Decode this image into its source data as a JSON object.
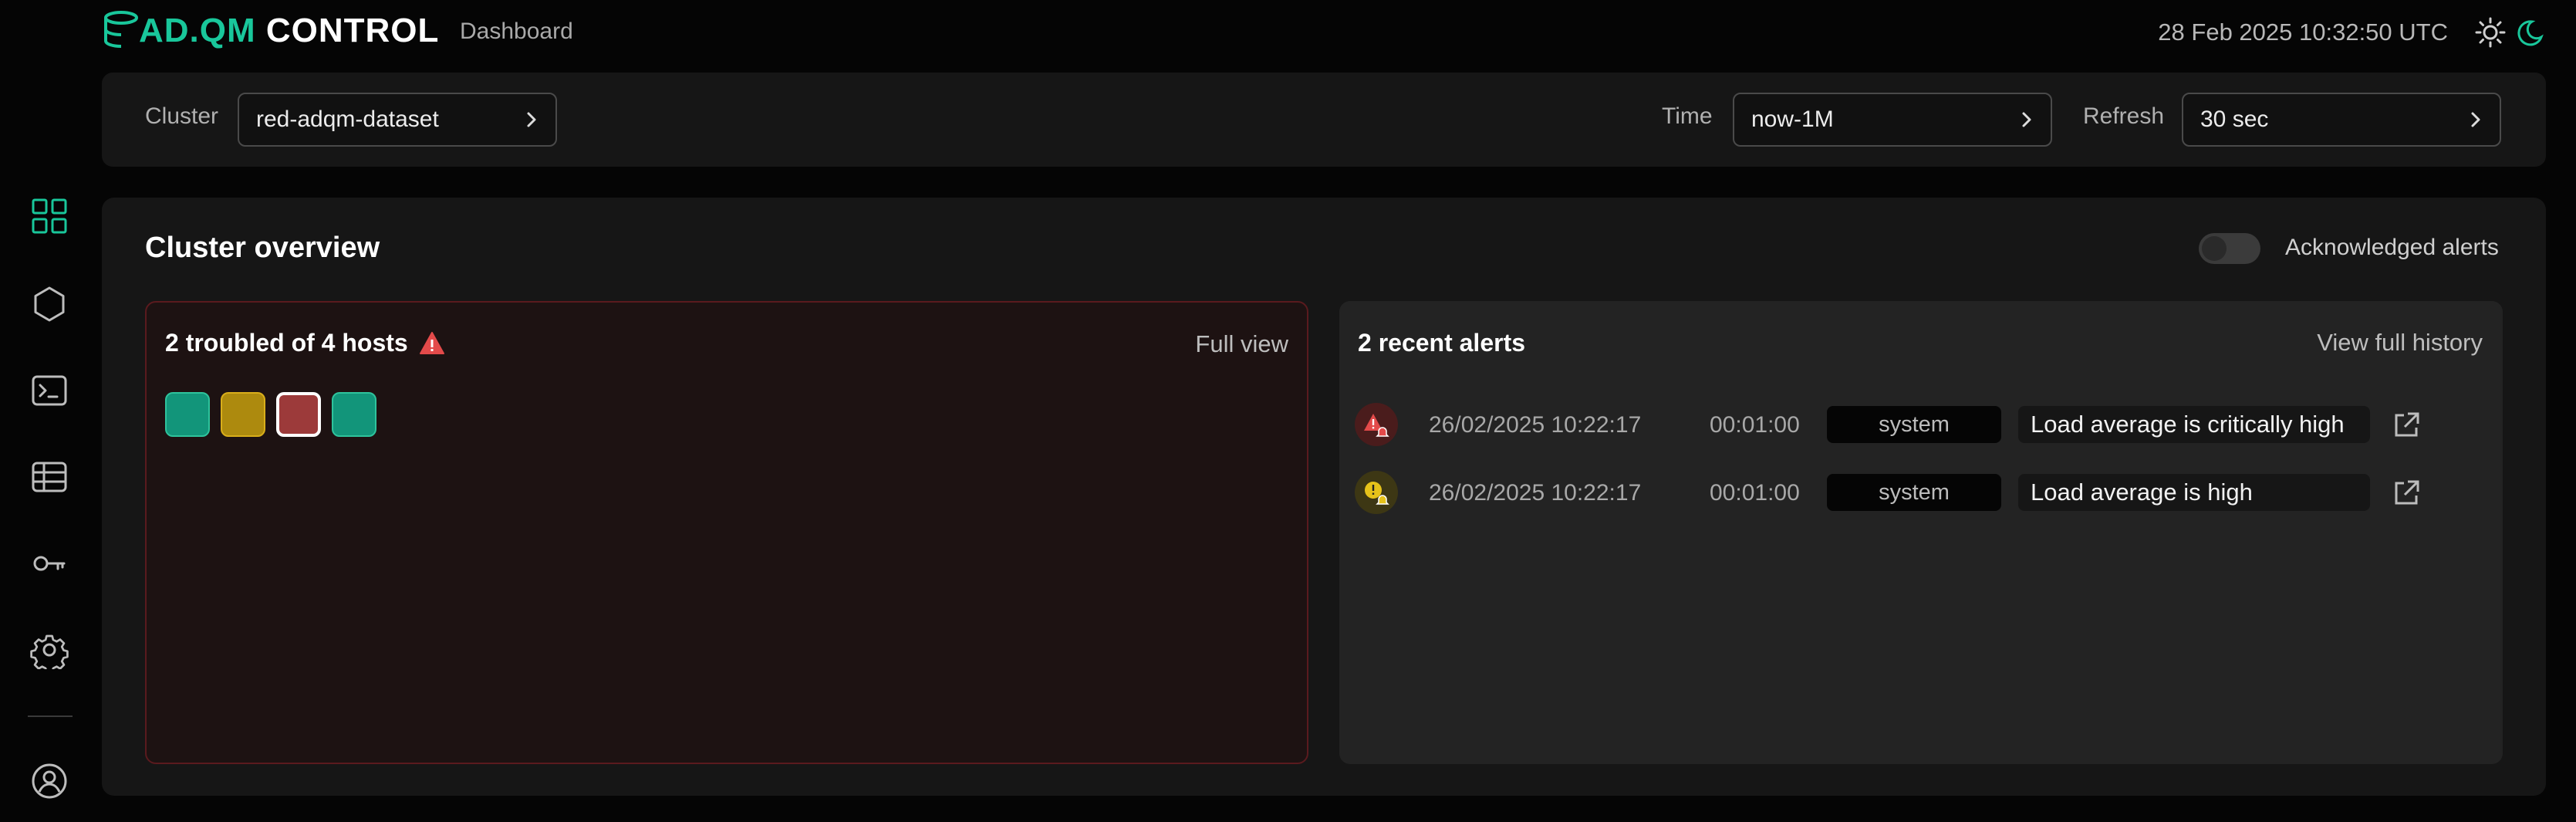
{
  "app": {
    "logo_part1": "AD.QM",
    "logo_part2": " CONTROL",
    "nav_item": "Dashboard",
    "datetime": "28 Feb 2025  10:32:50 UTC"
  },
  "sidebar": {
    "items": [
      {
        "icon": "dashboard-grid-icon",
        "active": true
      },
      {
        "icon": "hexagon-icon",
        "active": false
      },
      {
        "icon": "terminal-icon",
        "active": false
      },
      {
        "icon": "table-icon",
        "active": false
      },
      {
        "icon": "key-icon",
        "active": false
      },
      {
        "icon": "gear-icon",
        "active": false
      },
      {
        "icon": "user-profile-icon",
        "active": false
      }
    ]
  },
  "filters": {
    "cluster_label": "Cluster",
    "cluster_value": "red-adqm-dataset",
    "time_label": "Time",
    "time_value": "now-1M",
    "refresh_label": "Refresh",
    "refresh_value": "30 sec"
  },
  "overview": {
    "title": "Cluster overview",
    "ack_label": "Acknowledged alerts",
    "ack_enabled": false
  },
  "hosts": {
    "title": "2 troubled of 4 hosts",
    "full_view": "Full view",
    "items": [
      {
        "status": "ok",
        "color": "#12957a"
      },
      {
        "status": "warning",
        "color": "#ad8a0e"
      },
      {
        "status": "critical",
        "color": "#9c3a3a"
      },
      {
        "status": "ok",
        "color": "#12957a"
      }
    ]
  },
  "alerts": {
    "title": "2 recent alerts",
    "history_link": "View full history",
    "rows": [
      {
        "severity": "critical",
        "date": "26/02/2025 10:22:17",
        "duration": "00:01:00",
        "source": "system",
        "message": "Load average is critically high"
      },
      {
        "severity": "warning",
        "date": "26/02/2025 10:22:17",
        "duration": "00:01:00",
        "source": "system",
        "message": "Load average is high"
      }
    ]
  },
  "colors": {
    "accent": "#19c79b",
    "critical": "#e34a4a",
    "warning": "#e6c21a",
    "background": "#050505",
    "panel": "#161616"
  }
}
